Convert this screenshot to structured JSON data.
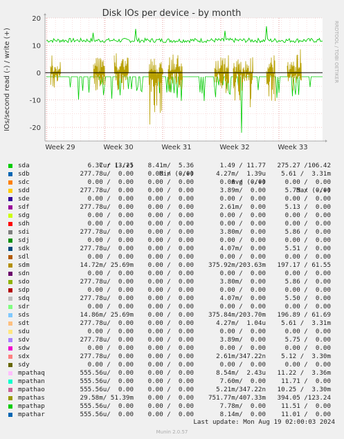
{
  "chart_data": {
    "type": "line",
    "title": "Disk IOs per device - by month",
    "ylabel": "IOs/second read (-) / write (+)",
    "ylim": [
      -25,
      20
    ],
    "yticks": [
      20,
      10,
      0,
      -10,
      -20
    ],
    "xticks": [
      "Week 29",
      "Week 30",
      "Week 31",
      "Week 32",
      "Week 33"
    ],
    "grid": true,
    "side_text": "RRDTOOL / TOBI OETIKER",
    "series_approx": [
      {
        "name": "sda write",
        "color": "#00cc00",
        "baseline": 11.8,
        "peaks": [
          14.6,
          16.0,
          15.3,
          17.0
        ]
      },
      {
        "name": "sda read",
        "color": "#00cc00",
        "baseline": -1.5,
        "dips": [
          -19.5,
          -22.0,
          -21.0,
          -14.5
        ]
      },
      {
        "name": "sdm / sds write",
        "color": "#b8a000",
        "peaks": [
          6.5,
          8.5,
          9.0
        ]
      },
      {
        "name": "sdm / sds read",
        "color": "#b8a000",
        "dips": [
          -8.0,
          -10.0,
          -14.0,
          -22.0
        ]
      }
    ]
  },
  "legend": {
    "headers": [
      "Cur (-/+)",
      "Min (-/+)",
      "Avg (-/+)",
      "Max (-/+)"
    ],
    "rows": [
      {
        "name": "sda",
        "color": "#00cc00",
        "cur": "6.37 / 13.25",
        "min": "8.41m/  5.36",
        "avg": "1.49 / 11.77",
        "max": "275.27 /106.42"
      },
      {
        "name": "sdb",
        "color": "#0066b3",
        "cur": "277.78u/  0.00",
        "min": "0.00 /  0.00",
        "avg": "4.27m/  1.39u",
        "max": "5.61 /  3.31m"
      },
      {
        "name": "sdc",
        "color": "#ff8000",
        "cur": "0.00 /  0.00",
        "min": "0.00 /  0.00",
        "avg": "0.00 /  0.00",
        "max": "0.00 /  0.00"
      },
      {
        "name": "sdd",
        "color": "#ffcc00",
        "cur": "277.78u/  0.00",
        "min": "0.00 /  0.00",
        "avg": "3.89m/  0.00",
        "max": "5.75 /  0.00"
      },
      {
        "name": "sde",
        "color": "#330099",
        "cur": "0.00 /  0.00",
        "min": "0.00 /  0.00",
        "avg": "0.00 /  0.00",
        "max": "0.00 /  0.00"
      },
      {
        "name": "sdf",
        "color": "#990099",
        "cur": "277.78u/  0.00",
        "min": "0.00 /  0.00",
        "avg": "2.61m/  0.00",
        "max": "5.13 /  0.00"
      },
      {
        "name": "sdg",
        "color": "#ccff00",
        "cur": "0.00 /  0.00",
        "min": "0.00 /  0.00",
        "avg": "0.00 /  0.00",
        "max": "0.00 /  0.00"
      },
      {
        "name": "sdh",
        "color": "#ff0000",
        "cur": "0.00 /  0.00",
        "min": "0.00 /  0.00",
        "avg": "0.00 /  0.00",
        "max": "0.00 /  0.00"
      },
      {
        "name": "sdi",
        "color": "#808080",
        "cur": "277.78u/  0.00",
        "min": "0.00 /  0.00",
        "avg": "3.80m/  0.00",
        "max": "5.86 /  0.00"
      },
      {
        "name": "sdj",
        "color": "#008f00",
        "cur": "0.00 /  0.00",
        "min": "0.00 /  0.00",
        "avg": "0.00 /  0.00",
        "max": "0.00 /  0.00"
      },
      {
        "name": "sdk",
        "color": "#00487d",
        "cur": "277.78u/  0.00",
        "min": "0.00 /  0.00",
        "avg": "4.07m/  0.00",
        "max": "5.51 /  0.00"
      },
      {
        "name": "sdl",
        "color": "#b35a00",
        "cur": "0.00 /  0.00",
        "min": "0.00 /  0.00",
        "avg": "0.00 /  0.00",
        "max": "0.00 /  0.00"
      },
      {
        "name": "sdm",
        "color": "#b38f00",
        "cur": "14.72m/ 25.69m",
        "min": "0.00 /  0.00",
        "avg": "375.92m/203.63m",
        "max": "197.17 / 61.55"
      },
      {
        "name": "sdn",
        "color": "#6b006b",
        "cur": "0.00 /  0.00",
        "min": "0.00 /  0.00",
        "avg": "0.00 /  0.00",
        "max": "0.00 /  0.00"
      },
      {
        "name": "sdo",
        "color": "#8fb300",
        "cur": "277.78u/  0.00",
        "min": "0.00 /  0.00",
        "avg": "3.80m/  0.00",
        "max": "5.86 /  0.00"
      },
      {
        "name": "sdp",
        "color": "#b30000",
        "cur": "0.00 /  0.00",
        "min": "0.00 /  0.00",
        "avg": "0.00 /  0.00",
        "max": "0.00 /  0.00"
      },
      {
        "name": "sdq",
        "color": "#bebebe",
        "cur": "277.78u/  0.00",
        "min": "0.00 /  0.00",
        "avg": "4.07m/  0.00",
        "max": "5.50 /  0.00"
      },
      {
        "name": "sdr",
        "color": "#80ff80",
        "cur": "0.00 /  0.00",
        "min": "0.00 /  0.00",
        "avg": "0.00 /  0.00",
        "max": "0.00 /  0.00"
      },
      {
        "name": "sds",
        "color": "#80c9ff",
        "cur": "14.86m/ 25.69m",
        "min": "0.00 /  0.00",
        "avg": "375.84m/203.70m",
        "max": "196.89 / 61.69"
      },
      {
        "name": "sdt",
        "color": "#ffc080",
        "cur": "277.78u/  0.00",
        "min": "0.00 /  0.00",
        "avg": "4.27m/  1.04u",
        "max": "5.61 /  3.31m"
      },
      {
        "name": "sdu",
        "color": "#ffe680",
        "cur": "0.00 /  0.00",
        "min": "0.00 /  0.00",
        "avg": "0.00 /  0.00",
        "max": "0.00 /  0.00"
      },
      {
        "name": "sdv",
        "color": "#aa80ff",
        "cur": "277.78u/  0.00",
        "min": "0.00 /  0.00",
        "avg": "3.89m/  0.00",
        "max": "5.75 /  0.00"
      },
      {
        "name": "sdw",
        "color": "#ee00cc",
        "cur": "0.00 /  0.00",
        "min": "0.00 /  0.00",
        "avg": "0.00 /  0.00",
        "max": "0.00 /  0.00"
      },
      {
        "name": "sdx",
        "color": "#ff8080",
        "cur": "277.78u/  0.00",
        "min": "0.00 /  0.00",
        "avg": "2.61m/347.22n",
        "max": "5.12 /  3.30m"
      },
      {
        "name": "sdy",
        "color": "#666600",
        "cur": "0.00 /  0.00",
        "min": "0.00 /  0.00",
        "avg": "0.00 /  0.00",
        "max": "0.00 /  0.00"
      },
      {
        "name": "mpathaq",
        "color": "#ffbfff",
        "cur": "555.56u/  0.00",
        "min": "0.00 /  0.00",
        "avg": "8.54m/  2.43u",
        "max": "11.22 /  3.36m"
      },
      {
        "name": "mpathan",
        "color": "#00ffcc",
        "cur": "555.56u/  0.00",
        "min": "0.00 /  0.00",
        "avg": "7.60m/  0.00",
        "max": "11.71 /  0.00"
      },
      {
        "name": "mpathao",
        "color": "#cc6699",
        "cur": "555.56u/  0.00",
        "min": "0.00 /  0.00",
        "avg": "5.21m/347.22n",
        "max": "10.25 /  3.30m"
      },
      {
        "name": "mpathas",
        "color": "#999900",
        "cur": "29.58m/ 51.39m",
        "min": "0.00 /  0.00",
        "avg": "751.77m/407.33m",
        "max": "394.05 /123.24"
      },
      {
        "name": "mpathap",
        "color": "#00cc00",
        "cur": "555.56u/  0.00",
        "min": "0.00 /  0.00",
        "avg": "7.78m/  0.00",
        "max": "11.51 /  0.00"
      },
      {
        "name": "mpathar",
        "color": "#0066b3",
        "cur": "555.56u/  0.00",
        "min": "0.00 /  0.00",
        "avg": "8.14m/  0.00",
        "max": "11.01 /  0.00"
      }
    ]
  },
  "last_update": "Last update: Mon Aug 19 02:00:03 2024",
  "footer": "Munin 2.0.57"
}
